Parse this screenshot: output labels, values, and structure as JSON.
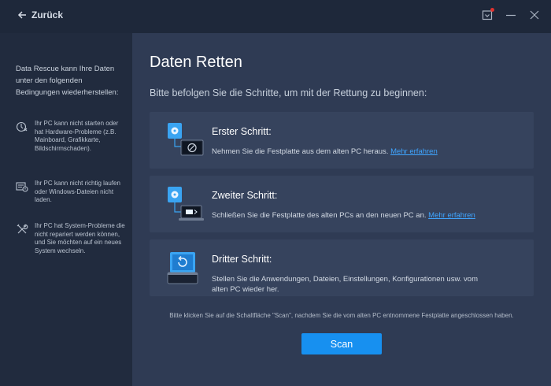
{
  "titlebar": {
    "back_label": "Zurück",
    "icons": [
      "arrow-left-icon",
      "notification-icon",
      "minimize-icon",
      "close-icon"
    ]
  },
  "sidebar": {
    "intro": "Data Rescue kann Ihre Daten unter den folgenden Bedingungen wiederherstellen:",
    "items": [
      {
        "icon": "broken-pc-icon",
        "text": "Ihr PC kann nicht starten oder hat Hardware-Probleme (z.B. Mainboard, Grafikkarte, Bildschirmschaden)."
      },
      {
        "icon": "windows-error-icon",
        "text": "Ihr PC kann nicht richtig laufen oder Windows-Dateien nicht laden."
      },
      {
        "icon": "tools-icon",
        "text": "Ihr PC hat System-Probleme die nicht repariert werden können, und Sie möchten auf ein neues System wechseln."
      }
    ]
  },
  "main": {
    "title": "Daten Retten",
    "subtitle": "Bitte befolgen Sie die Schritte, um mit der Rettung zu beginnen:",
    "steps": [
      {
        "title": "Erster Schritt:",
        "desc": "Nehmen Sie die Festplatte aus dem alten PC heraus.",
        "link": "Mehr erfahren"
      },
      {
        "title": "Zweiter Schritt:",
        "desc": "Schließen Sie die Festplatte des alten PCs an den neuen PC an.",
        "link": "Mehr erfahren"
      },
      {
        "title": "Dritter Schritt:",
        "desc": "Stellen Sie die Anwendungen, Dateien, Einstellungen, Konfigurationen usw. vom alten PC wieder her."
      }
    ],
    "note": "Bitte klicken Sie auf die Schaltfläche \"Scan\", nachdem Sie die vom alten PC entnommene Festplatte angeschlossen haben.",
    "scan_label": "Scan"
  },
  "colors": {
    "accent": "#1790f0",
    "link": "#3fa5ff",
    "sidebar_bg": "#212b3e",
    "main_bg": "#2f3b54",
    "card_bg": "#36435d",
    "notification": "#e0322f"
  }
}
